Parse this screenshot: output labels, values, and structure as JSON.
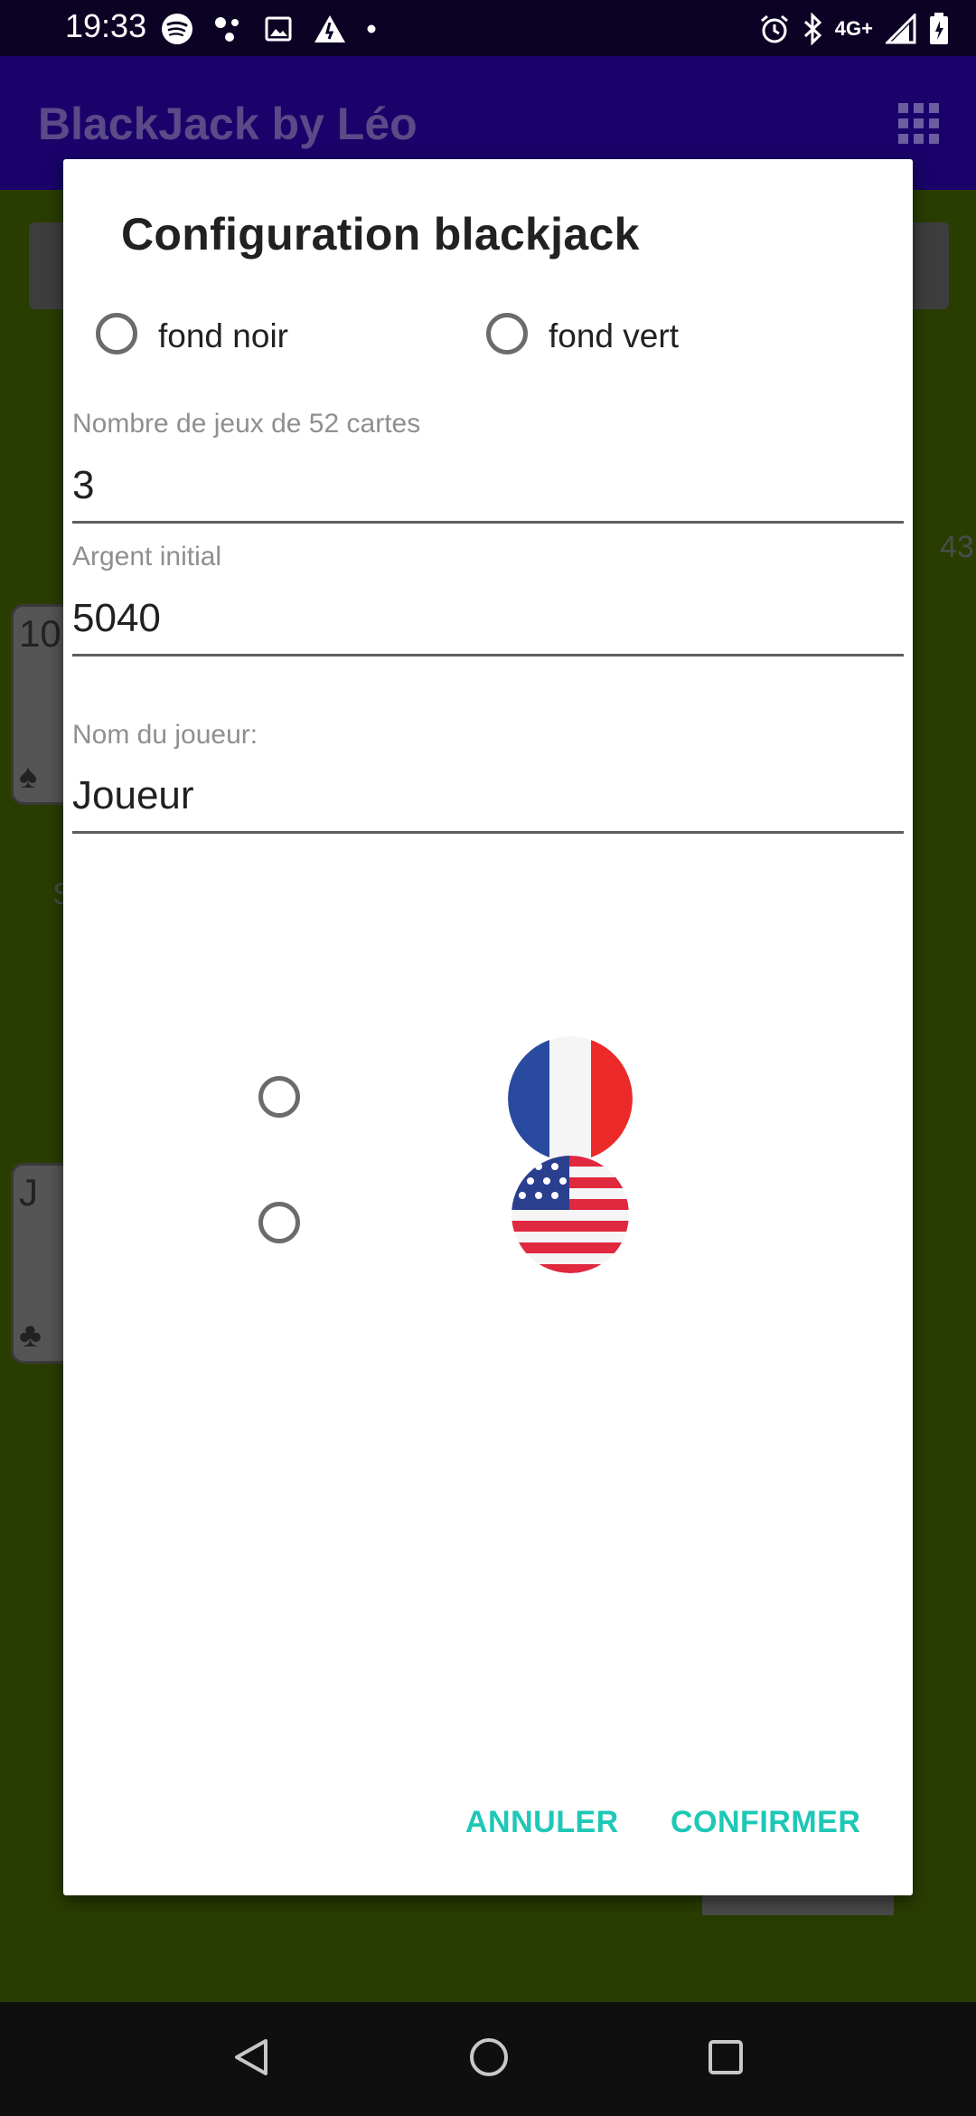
{
  "status_bar": {
    "time": "19:33",
    "network": "4G+",
    "left_icons": [
      "spotify-icon",
      "dots-icon",
      "image-icon",
      "warning-icon",
      "dot-icon"
    ],
    "right_icons": [
      "alarm-icon",
      "bluetooth-icon",
      "network-type",
      "signal-icon",
      "battery-icon"
    ]
  },
  "app_bar": {
    "title": "BlackJack by Léo",
    "menu_icon": "grid-icon"
  },
  "background": {
    "card_1": {
      "rank": "10",
      "suit": "♠"
    },
    "card_2": {
      "rank": "J",
      "suit": "♣"
    },
    "side_number": "43",
    "side_letter": "S"
  },
  "dialog": {
    "title": "Configuration blackjack",
    "background_options": [
      {
        "label": "fond noir",
        "checked": false
      },
      {
        "label": "fond vert",
        "checked": false
      }
    ],
    "decks": {
      "label": "Nombre de jeux de 52 cartes",
      "value": "3"
    },
    "money": {
      "label": "Argent initial",
      "value": "5040"
    },
    "player": {
      "label": "Nom du joueur:",
      "value": "Joueur"
    },
    "language_options": [
      {
        "name": "french-flag-icon",
        "checked": false
      },
      {
        "name": "usa-flag-icon",
        "checked": false
      }
    ],
    "cancel_label": "ANNULER",
    "confirm_label": "CONFIRMER",
    "accent_color": "#1EC7B6"
  },
  "nav_bar": {
    "buttons": [
      "back-icon",
      "home-icon",
      "recents-icon"
    ]
  },
  "colors": {
    "app_bar": "#19036B",
    "status_bar": "#0C0324",
    "scrim_game": "#2A3D00"
  }
}
